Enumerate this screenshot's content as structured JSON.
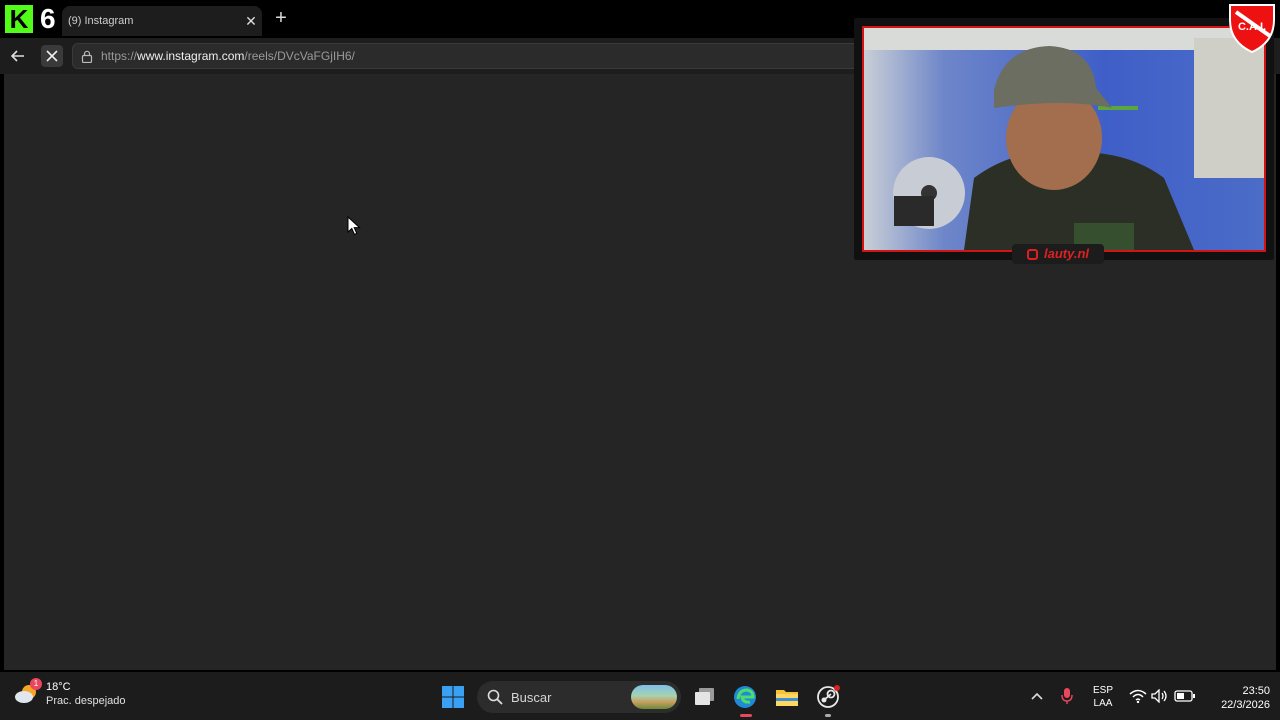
{
  "browser": {
    "tab": {
      "title": "(9) Instagram"
    },
    "address_bar": {
      "scheme": "https://",
      "host": "www.instagram.com",
      "path": "/reels/DVcVaFGjIH6/"
    }
  },
  "overlay": {
    "kick_letter": "K",
    "kick_color": "#53fc18",
    "number": "6",
    "webcam_handle": "lauty.nl",
    "border_color": "#d41414",
    "club_badge": "C.A.I."
  },
  "taskbar": {
    "weather": {
      "temperature": "18°C",
      "description": "Prac. despejado",
      "badge": "1"
    },
    "search": {
      "placeholder": "Buscar"
    },
    "lang": {
      "line1": "ESP",
      "line2": "LAA"
    },
    "clock": {
      "time": "23:50",
      "date": "22/3/2026"
    }
  }
}
